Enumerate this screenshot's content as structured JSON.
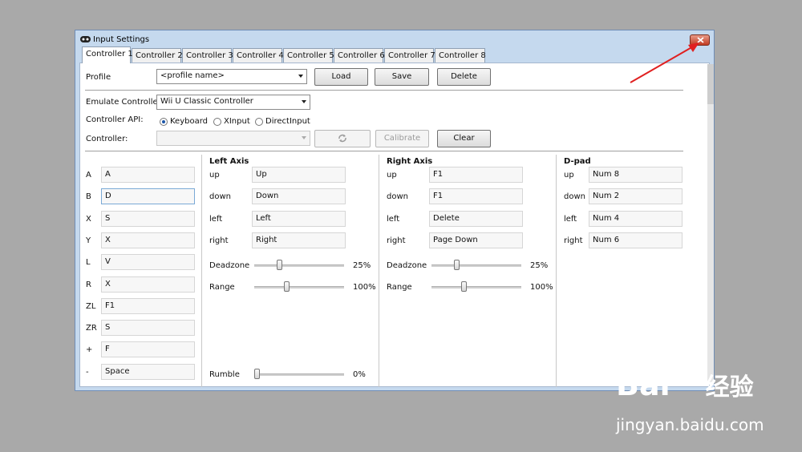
{
  "window": {
    "title": "Input Settings"
  },
  "tabs": [
    {
      "label": "Controller 1",
      "active": true
    },
    {
      "label": "Controller 2",
      "active": false
    },
    {
      "label": "Controller 3",
      "active": false
    },
    {
      "label": "Controller 4",
      "active": false
    },
    {
      "label": "Controller 5",
      "active": false
    },
    {
      "label": "Controller 6",
      "active": false
    },
    {
      "label": "Controller 7",
      "active": false
    },
    {
      "label": "Controller 8",
      "active": false
    }
  ],
  "profile": {
    "label": "Profile",
    "value": "<profile name>",
    "load": "Load",
    "save": "Save",
    "delete": "Delete"
  },
  "emulate": {
    "label": "Emulate Controller",
    "value": "Wii U Classic Controller"
  },
  "api": {
    "label": "Controller API:",
    "options": [
      "Keyboard",
      "XInput",
      "DirectInput"
    ],
    "selected": "Keyboard"
  },
  "controller": {
    "label": "Controller:",
    "value": "",
    "calibrate": "Calibrate",
    "clear": "Clear"
  },
  "buttons": [
    {
      "key": "A",
      "value": "A"
    },
    {
      "key": "B",
      "value": "D"
    },
    {
      "key": "X",
      "value": "S"
    },
    {
      "key": "Y",
      "value": "X"
    },
    {
      "key": "L",
      "value": "V"
    },
    {
      "key": "R",
      "value": "X"
    },
    {
      "key": "ZL",
      "value": "F1"
    },
    {
      "key": "ZR",
      "value": "S"
    },
    {
      "key": "+",
      "value": "F"
    },
    {
      "key": "-",
      "value": "Space"
    }
  ],
  "left_axis": {
    "title": "Left Axis",
    "rows": [
      {
        "dir": "up",
        "value": "Up"
      },
      {
        "dir": "down",
        "value": "Down"
      },
      {
        "dir": "left",
        "value": "Left"
      },
      {
        "dir": "right",
        "value": "Right"
      }
    ],
    "deadzone": {
      "label": "Deadzone",
      "text": "25%",
      "value": 0.25
    },
    "range": {
      "label": "Range",
      "text": "100%",
      "value": 0.33
    },
    "rumble": {
      "label": "Rumble",
      "text": "0%",
      "value": 0
    }
  },
  "right_axis": {
    "title": "Right Axis",
    "rows": [
      {
        "dir": "up",
        "value": "F1"
      },
      {
        "dir": "down",
        "value": "F1"
      },
      {
        "dir": "left",
        "value": "Delete"
      },
      {
        "dir": "right",
        "value": "Page Down"
      }
    ],
    "deadzone": {
      "label": "Deadzone",
      "text": "25%",
      "value": 0.25
    },
    "range": {
      "label": "Range",
      "text": "100%",
      "value": 0.33
    }
  },
  "dpad": {
    "title": "D-pad",
    "rows": [
      {
        "dir": "up",
        "value": "Num 8"
      },
      {
        "dir": "down",
        "value": "Num 2"
      },
      {
        "dir": "left",
        "value": "Num 4"
      },
      {
        "dir": "right",
        "value": "Num 6"
      }
    ]
  },
  "watermark": {
    "brand": "Bai",
    "brand_suffix": "经验",
    "url": "jingyan.baidu.com"
  },
  "colors": {
    "annotation_arrow": "#e02020",
    "titlebar": "#c5d9ee",
    "close_button": "#c13b22"
  }
}
